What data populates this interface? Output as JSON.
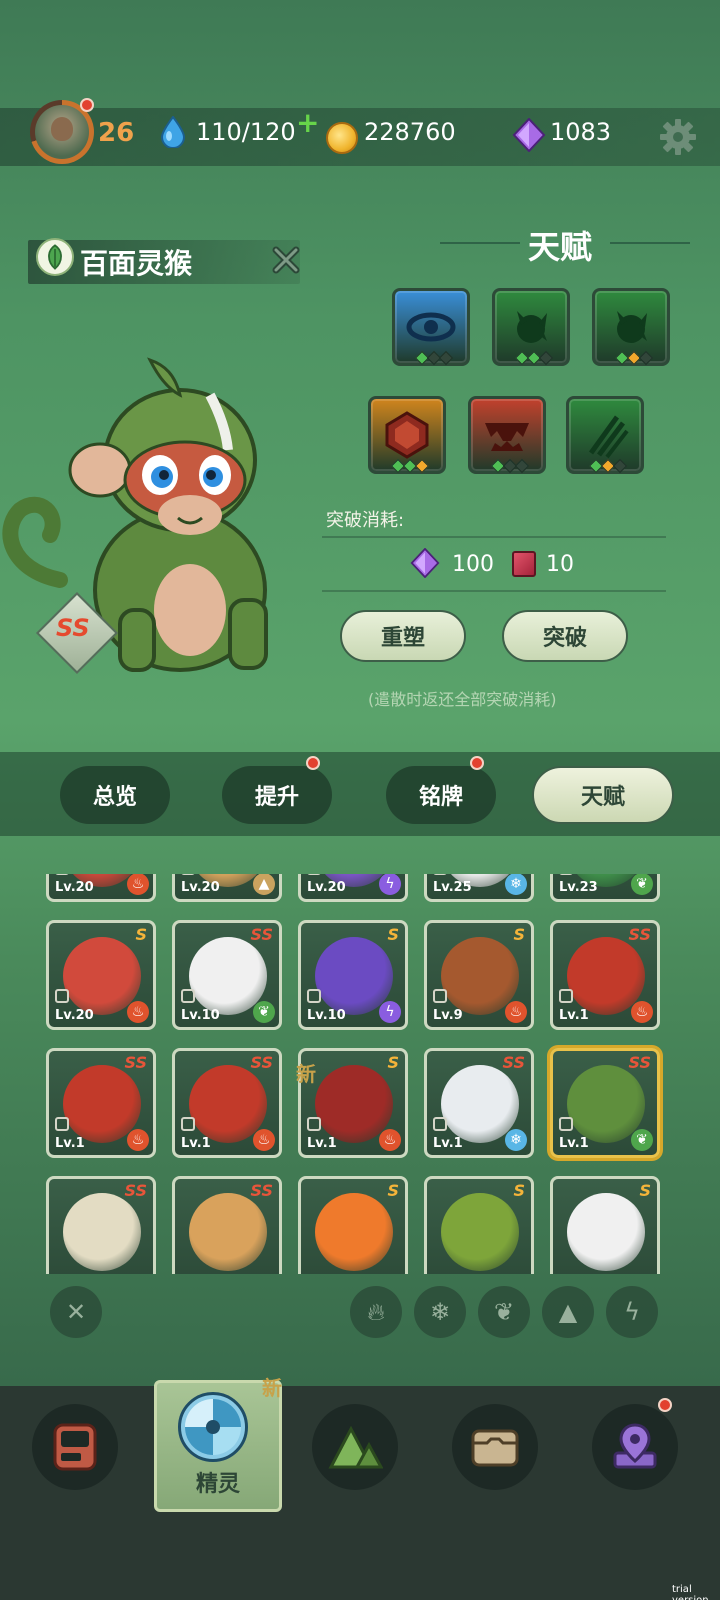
{
  "header": {
    "level": "26",
    "energy": "110/120",
    "coins": "228760",
    "gems": "1083"
  },
  "pet": {
    "name": "百面灵猴",
    "rank": "SS"
  },
  "talent": {
    "title": "天赋",
    "cost_label": "突破消耗:",
    "cost_gem": "100",
    "cost_book": "10",
    "reset_label": "重塑",
    "break_label": "突破",
    "note": "(遣散时返还全部突破消耗)",
    "cards": [
      {
        "icon": "eye-icon",
        "color": "#3a8fd8",
        "diamonds": [
          "#4fbf55",
          "#32463a",
          "#32463a"
        ]
      },
      {
        "icon": "claw-icon",
        "color": "#2f8a3e",
        "diamonds": [
          "#4fbf55",
          "#4fbf55",
          "#32463a"
        ]
      },
      {
        "icon": "claw-icon",
        "color": "#2f8a3e",
        "diamonds": [
          "#4fbf55",
          "#f2a82c",
          "#32463a"
        ]
      },
      {
        "icon": "shield-icon",
        "color": "#d0851d",
        "diamonds": [
          "#4fbf55",
          "#4fbf55",
          "#f2a82c"
        ]
      },
      {
        "icon": "fang-icon",
        "color": "#c2412d",
        "diamonds": [
          "#4fbf55",
          "#32463a",
          "#32463a"
        ]
      },
      {
        "icon": "scratch-icon",
        "color": "#2f8a3e",
        "diamonds": [
          "#4fbf55",
          "#f2a82c",
          "#32463a"
        ]
      }
    ]
  },
  "tabs": [
    "总览",
    "提升",
    "铭牌",
    "天赋"
  ],
  "grid": {
    "new_mark": "新",
    "rows": [
      [
        {
          "lv": "Lv.20",
          "rank": "",
          "el": "fire",
          "color": "#c8473a"
        },
        {
          "lv": "Lv.20",
          "rank": "",
          "el": "earth",
          "color": "#d2a15c"
        },
        {
          "lv": "Lv.20",
          "rank": "",
          "el": "thunder",
          "color": "#7a55c4"
        },
        {
          "lv": "Lv.25",
          "rank": "",
          "el": "ice",
          "color": "#e9e9e9"
        },
        {
          "lv": "Lv.23",
          "rank": "",
          "el": "wood",
          "color": "#3f8e4a"
        }
      ],
      [
        {
          "lv": "Lv.20",
          "rank": "S",
          "el": "fire",
          "color": "#d14a3c"
        },
        {
          "lv": "Lv.10",
          "rank": "SS",
          "el": "wood",
          "color": "#f0f0f0"
        },
        {
          "lv": "Lv.10",
          "rank": "S",
          "el": "thunder",
          "color": "#6b4bc2"
        },
        {
          "lv": "Lv.9",
          "rank": "S",
          "el": "fire",
          "color": "#a5592f"
        },
        {
          "lv": "Lv.1",
          "rank": "SS",
          "el": "fire",
          "color": "#c23a2a"
        }
      ],
      [
        {
          "lv": "Lv.1",
          "rank": "SS",
          "el": "fire",
          "color": "#c23a2a"
        },
        {
          "lv": "Lv.1",
          "rank": "SS",
          "el": "fire",
          "color": "#c23a2a"
        },
        {
          "lv": "Lv.1",
          "rank": "S",
          "el": "fire",
          "color": "#9e2b27"
        },
        {
          "lv": "Lv.1",
          "rank": "SS",
          "el": "ice",
          "color": "#e8ecef"
        },
        {
          "lv": "Lv.1",
          "rank": "SS",
          "el": "wood",
          "color": "#5f8f3d"
        }
      ],
      [
        {
          "lv": "",
          "rank": "SS",
          "el": "",
          "color": "#e3dcc3"
        },
        {
          "lv": "",
          "rank": "SS",
          "el": "",
          "color": "#d9a25c"
        },
        {
          "lv": "",
          "rank": "S",
          "el": "",
          "color": "#ef7a2c"
        },
        {
          "lv": "",
          "rank": "S",
          "el": "",
          "color": "#7ea53a"
        },
        {
          "lv": "",
          "rank": "S",
          "el": "",
          "color": "#f0f0f0"
        }
      ]
    ]
  },
  "filters": [
    "✕",
    "fire",
    "ice",
    "wood",
    "earth",
    "thunder"
  ],
  "nav": {
    "active_label": "精灵",
    "new_mark": "新"
  },
  "watermark": "trial version"
}
